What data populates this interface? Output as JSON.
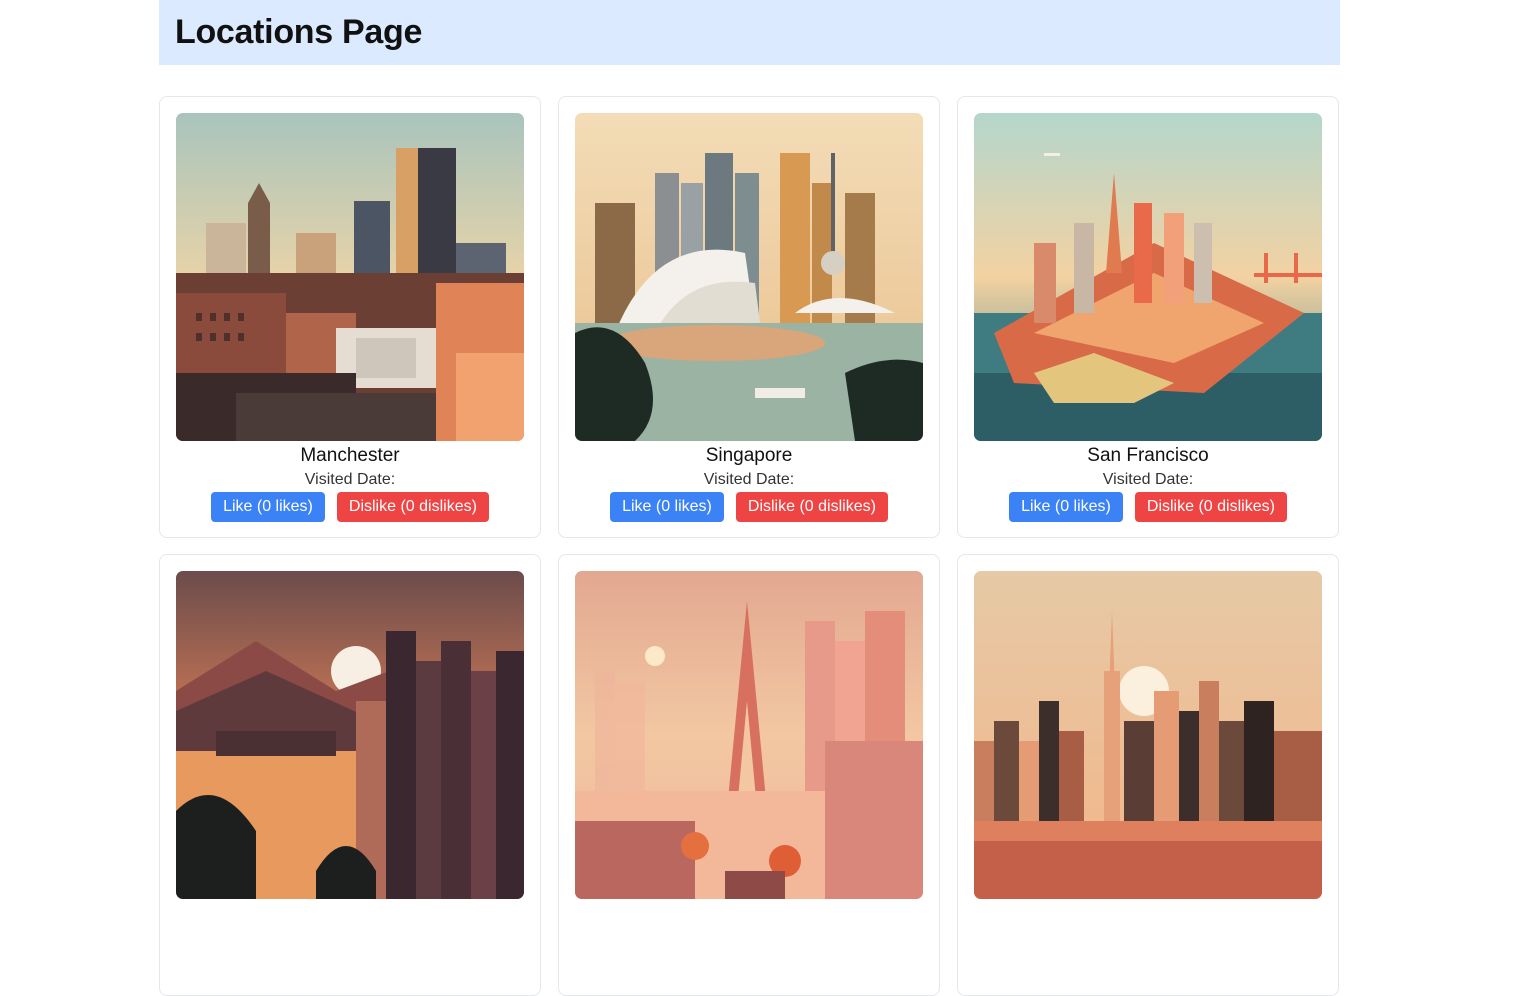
{
  "header": {
    "title": "Locations Page"
  },
  "labels": {
    "visited_date": "Visited Date:"
  },
  "locations": [
    {
      "name": "Manchester",
      "like_label": "Like (0 likes)",
      "dislike_label": "Dislike (0 dislikes)"
    },
    {
      "name": "Singapore",
      "like_label": "Like (0 likes)",
      "dislike_label": "Dislike (0 dislikes)"
    },
    {
      "name": "San Francisco",
      "like_label": "Like (0 likes)",
      "dislike_label": "Dislike (0 dislikes)"
    },
    {
      "name": "",
      "like_label": "",
      "dislike_label": ""
    },
    {
      "name": "",
      "like_label": "",
      "dislike_label": ""
    },
    {
      "name": "",
      "like_label": "",
      "dislike_label": ""
    }
  ],
  "colors": {
    "header_bg": "#dbeafe",
    "like": "#3b82f6",
    "dislike": "#ef4444"
  }
}
